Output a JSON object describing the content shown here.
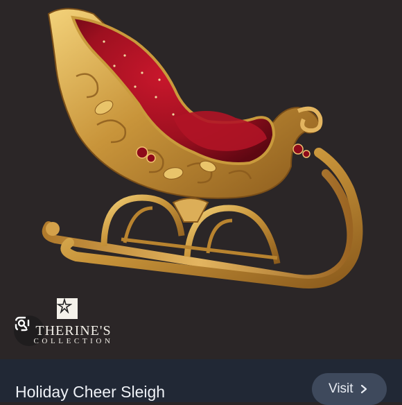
{
  "product": {
    "title": "Holiday Cheer Sleigh",
    "brand_name": "THERINE'S",
    "brand_sub": "COLLECTION",
    "brand_logo_icon": "star-box-icon"
  },
  "actions": {
    "visit_label": "Visit",
    "visit_icon": "chevron-right-icon",
    "lens_icon": "lens-search-icon"
  },
  "colors": {
    "background": "#2b2627",
    "bar": "#212835",
    "button": "#3e495c",
    "velvet": "#9e1020",
    "gold": "#c99a3c"
  }
}
